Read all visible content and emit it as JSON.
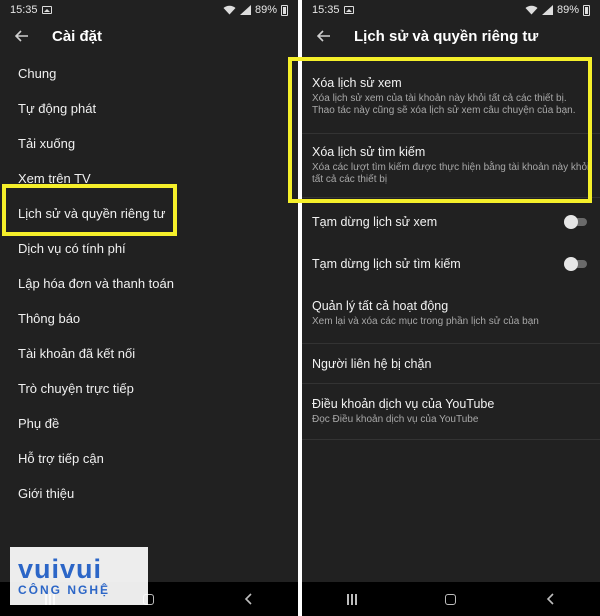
{
  "left": {
    "status": {
      "time": "15:35",
      "battery": "89%"
    },
    "title": "Cài đặt",
    "items": [
      "Chung",
      "Tự động phát",
      "Tải xuống",
      "Xem trên TV",
      "Lịch sử và quyền riêng tư",
      "Dịch vụ có tính phí",
      "Lập hóa đơn và thanh toán",
      "Thông báo",
      "Tài khoản đã kết nối",
      "Trò chuyện trực tiếp",
      "Phụ đề",
      "Hỗ trợ tiếp cận",
      "Giới thiệu"
    ]
  },
  "right": {
    "status": {
      "time": "15:35",
      "battery": "89%"
    },
    "title": "Lịch sử và quyền riêng tư",
    "clear_watch": {
      "title": "Xóa lịch sử xem",
      "desc": "Xóa lịch sử xem của tài khoản này khỏi tất cả các thiết bị. Thao tác này cũng sẽ xóa lịch sử xem câu chuyện của bạn."
    },
    "clear_search": {
      "title": "Xóa lịch sử tìm kiếm",
      "desc": "Xóa các lượt tìm kiếm được thực hiện bằng tài khoản này khỏi tất cả các thiết bị"
    },
    "pause_watch": {
      "title": "Tạm dừng lịch sử xem",
      "on": false
    },
    "pause_search": {
      "title": "Tạm dừng lịch sử tìm kiếm",
      "on": false
    },
    "manage": {
      "title": "Quản lý tất cả hoạt động",
      "desc": "Xem lại và xóa các mục trong phần lịch sử của bạn"
    },
    "blocked": {
      "title": "Người liên hệ bị chặn"
    },
    "terms": {
      "title": "Điều khoản dịch vụ của YouTube",
      "desc": "Đọc Điều khoản dịch vụ của YouTube"
    }
  },
  "watermark": {
    "top": "vuivui",
    "bottom": "CÔNG NGHỆ"
  },
  "colors": {
    "highlight": "#f5ef2a",
    "background": "#212121",
    "brand": "#2c66c7"
  }
}
